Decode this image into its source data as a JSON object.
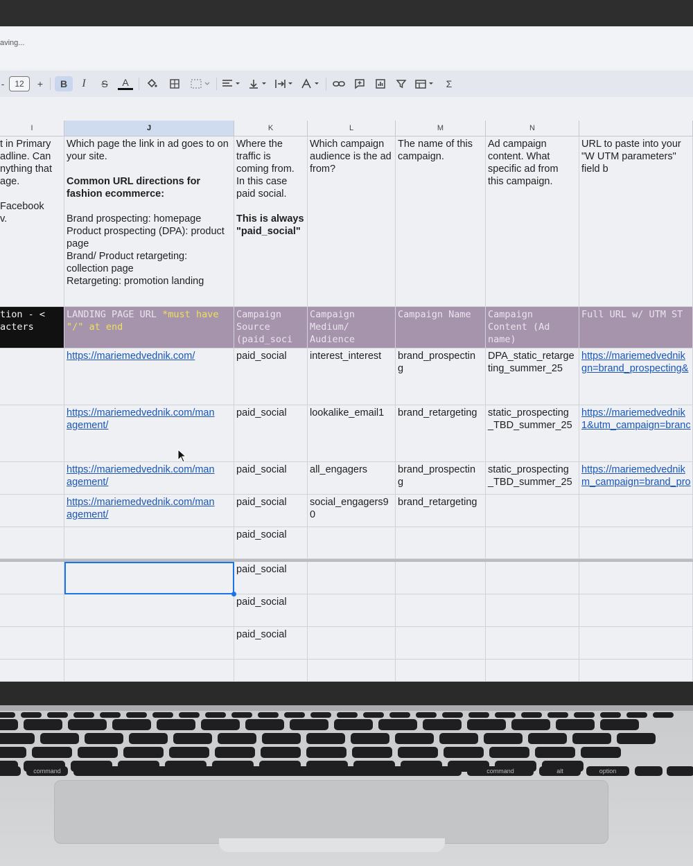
{
  "status": {
    "saving_text": "aving..."
  },
  "toolbar": {
    "minus": "-",
    "font_size": "12",
    "plus": "+",
    "bold": "B",
    "italic": "I",
    "strike": "S",
    "text_color": "A",
    "sigma": "Σ"
  },
  "columns": [
    "I",
    "J",
    "K",
    "L",
    "M",
    "N",
    ""
  ],
  "selected_column": "J",
  "descriptions": {
    "I": [
      "t in Primary",
      "adline. Can",
      "nything that",
      "age.",
      "",
      "Facebook",
      "v."
    ],
    "J_intro": "Which page the link in ad goes to on your site.",
    "J_bold": "Common URL directions for fashion ecommerce:",
    "J_list": [
      "Brand prospecting: homepage",
      "Product prospecting (DPA): product page",
      "Brand/ Product retargeting: collection page",
      "Retargeting: promotion landing"
    ],
    "K_text": "Where the traffic is coming from. In this case paid social.",
    "K_bold": "This is always \"paid_social\"",
    "L": "Which campaign audience is the ad from?",
    "M": "The name of this campaign.",
    "N": "Ad campaign content. What specific ad from this campaign.",
    "O": "URL to paste into your \"W UTM parameters\" field b"
  },
  "field_headers": {
    "I": "tion - < acters",
    "J_main": "LANDING PAGE URL ",
    "J_yellow": "*must have \"/\" at end",
    "K": "Campaign Source (paid_soci",
    "L": "Campaign Medium/ Audience",
    "M": "Campaign Name",
    "N": "Campaign Content (Ad name)",
    "O": "Full URL w/ UTM ST"
  },
  "rows": [
    {
      "J": "https://mariemedvednik.com/",
      "K": "paid_social",
      "L": "interest_interest",
      "M": "brand_prospectin g",
      "N": "DPA_static_retarge ting_summer_25",
      "O": "https://mariemedvednik gn=brand_prospecting&"
    },
    {
      "J": "https://mariemedvednik.com/man agement/",
      "K": "paid_social",
      "L": "lookalike_email1",
      "M": "brand_retargeting",
      "N": "static_prospecting _TBD_summer_25",
      "O": "https://mariemedvednik 1&utm_campaign=branc"
    },
    {
      "J": "https://mariemedvednik.com/man agement/",
      "K": "paid_social",
      "L": "all_engagers",
      "M": "brand_prospectin g",
      "N": "static_prospecting _TBD_summer_25",
      "O": "https://mariemedvednik m_campaign=brand_pro"
    },
    {
      "J": "https://mariemedvednik.com/man agement/",
      "K": "paid_social",
      "L": "social_engagers9 0",
      "M": "brand_retargeting",
      "N": "",
      "O": ""
    },
    {
      "J": "",
      "K": "paid_social",
      "L": "",
      "M": "",
      "N": "",
      "O": ""
    },
    {
      "J": "",
      "K": "paid_social",
      "L": "",
      "M": "",
      "N": "",
      "O": ""
    },
    {
      "J": "",
      "K": "paid_social",
      "L": "",
      "M": "",
      "N": "",
      "O": ""
    },
    {
      "J": "",
      "K": "paid_social",
      "L": "",
      "M": "",
      "N": "",
      "O": ""
    }
  ],
  "keyboard": {
    "command_left": "command",
    "command_right": "command",
    "option": "option",
    "alt": "alt"
  },
  "colors": {
    "header_purple": "#a594ab",
    "header_yellow": "#f0e05a",
    "link_blue": "#1a56b8",
    "selection_blue": "#1a73e8"
  }
}
